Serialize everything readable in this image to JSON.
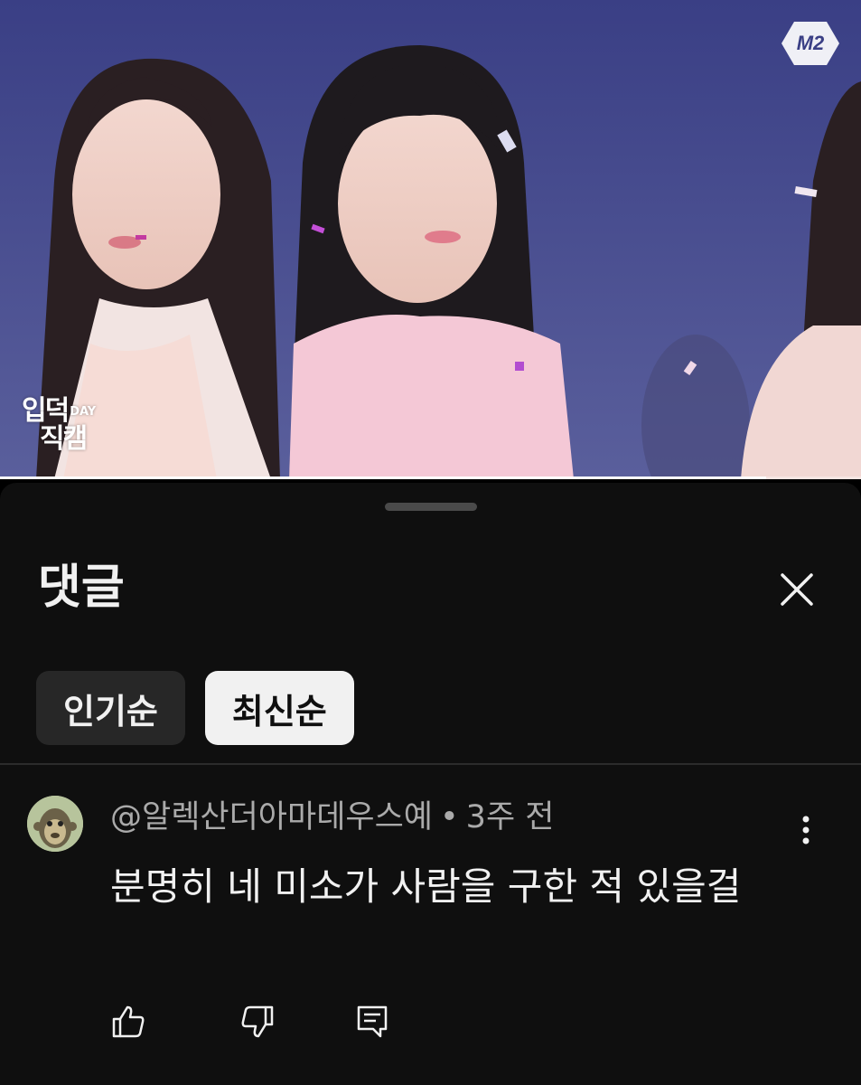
{
  "video": {
    "channel_logo": "M2",
    "watermark_line1": "입덕",
    "watermark_tag": "DAY",
    "watermark_line2": "직캠",
    "progress": 0.89
  },
  "comments_panel": {
    "title": "댓글",
    "close_icon": "close-icon",
    "sort_chips": [
      {
        "label": "인기순",
        "selected": false
      },
      {
        "label": "최신순",
        "selected": true
      }
    ],
    "comments": [
      {
        "author": "@알렉산더아마데우스예",
        "separator": "•",
        "time": "3주 전",
        "text": "분명히 네 미소가 사람을 구한 적 있을걸",
        "avatar_icon": "monkey-avatar"
      }
    ],
    "actions": {
      "like_icon": "thumbs-up-icon",
      "dislike_icon": "thumbs-down-icon",
      "reply_icon": "reply-icon"
    }
  },
  "colors": {
    "sheet_background": "#0f0f0f",
    "chip_inactive": "#272727",
    "chip_active": "#f1f1f1",
    "text_primary": "#f1f1f1",
    "text_secondary": "#aaaaaa"
  }
}
